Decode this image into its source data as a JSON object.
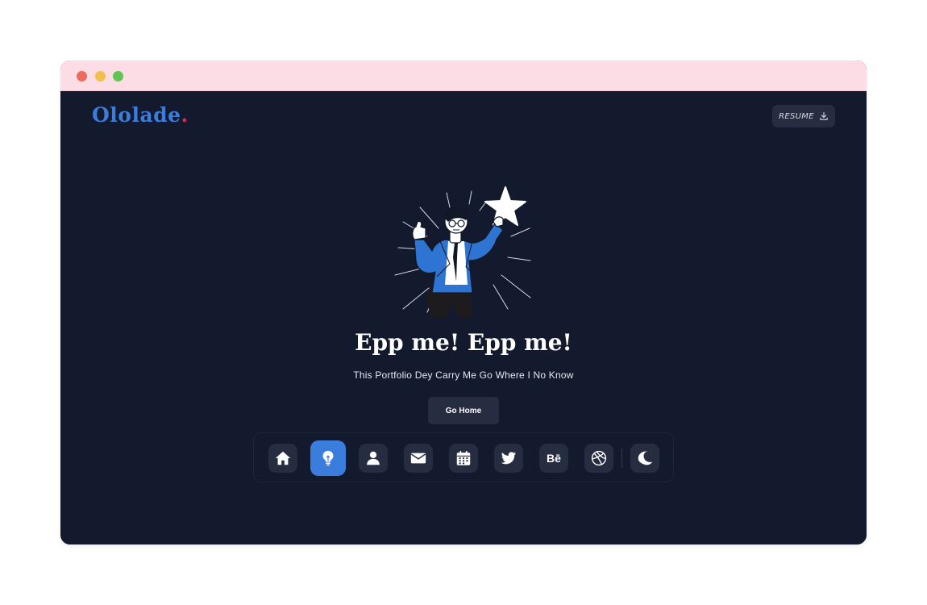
{
  "window": {
    "controls": [
      "close",
      "minimize",
      "maximize"
    ]
  },
  "header": {
    "logo_text": "Ololade",
    "logo_dot": ".",
    "resume_label": "RESUME",
    "resume_icon": "download-icon"
  },
  "hero": {
    "title": "Epp me! Epp me!",
    "subtitle": "This Portfolio Dey Carry Me Go Where I No Know",
    "button_label": "Go Home",
    "illustration": "man-holding-star"
  },
  "dock": {
    "items": [
      {
        "icon": "home-icon",
        "active": false
      },
      {
        "icon": "lightbulb-icon",
        "active": true
      },
      {
        "icon": "user-icon",
        "active": false
      },
      {
        "icon": "mail-icon",
        "active": false
      },
      {
        "icon": "calendar-icon",
        "active": false
      },
      {
        "icon": "twitter-icon",
        "active": false
      },
      {
        "icon": "behance-icon",
        "label": "Bē",
        "active": false
      },
      {
        "icon": "dribbble-icon",
        "active": false
      },
      {
        "icon": "moon-icon",
        "active": false
      }
    ]
  },
  "colors": {
    "background": "#141a2e",
    "accent": "#3b7ddd",
    "button": "#262d41",
    "titlebar": "#fcdde6",
    "logo_dot": "#e0245e"
  }
}
